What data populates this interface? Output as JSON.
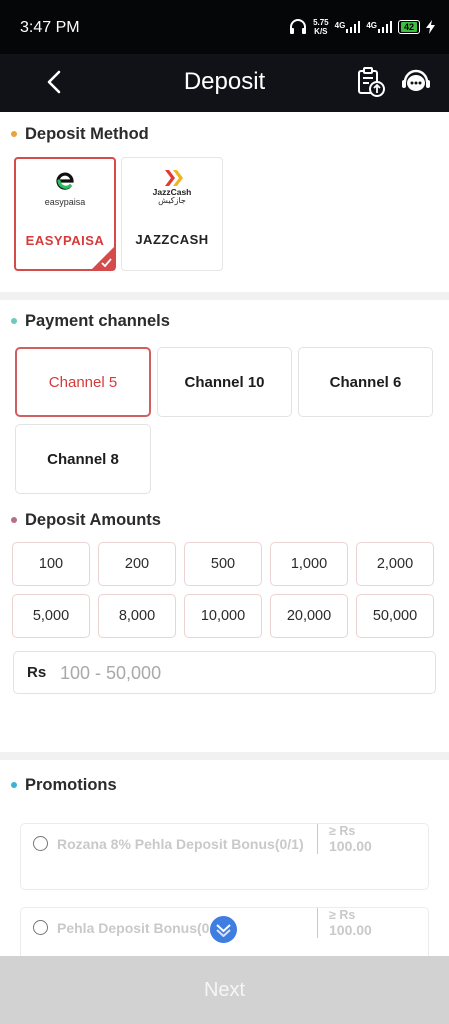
{
  "status_bar": {
    "time": "3:47 PM",
    "net_speed_value": "5.75",
    "net_speed_unit": "K/S",
    "signal1": "4G",
    "signal2": "4G",
    "battery": "42",
    "icons": [
      "headphones-icon",
      "signal-icon",
      "signal-icon",
      "battery-icon",
      "charging-icon"
    ]
  },
  "header": {
    "title": "Deposit",
    "back_icon": "chevron-left-icon",
    "history_icon": "clipboard-upload-icon",
    "support_icon": "customer-service-icon"
  },
  "deposit_method": {
    "title": "Deposit Method",
    "dot_color": "#e8a33a",
    "methods": [
      {
        "logo": "easypaisa",
        "label": "EASYPAISA",
        "selected": true
      },
      {
        "logo": "JazzCash",
        "logo_sub": "جازکیش",
        "label": "JAZZCASH",
        "selected": false
      }
    ]
  },
  "payment_channels": {
    "title": "Payment channels",
    "dot_color": "#6fc7c0",
    "channels": [
      {
        "label": "Channel 5",
        "selected": true
      },
      {
        "label": "Channel 10",
        "selected": false
      },
      {
        "label": "Channel 6",
        "selected": false
      },
      {
        "label": "Channel 8",
        "selected": false
      }
    ]
  },
  "deposit_amounts": {
    "title": "Deposit Amounts",
    "dot_color": "#b76f86",
    "amounts": [
      "100",
      "200",
      "500",
      "1,000",
      "2,000",
      "5,000",
      "8,000",
      "10,000",
      "20,000",
      "50,000"
    ],
    "currency": "Rs",
    "placeholder": "100 - 50,000"
  },
  "promotions": {
    "title": "Promotions",
    "dot_color": "#3bb3d6",
    "items": [
      {
        "name": "Rozana 8% Pehla Deposit Bonus(0/1)",
        "min_prefix": "≥ Rs",
        "min_amount": "100.00"
      },
      {
        "name": "Pehla Deposit Bonus(0/1)",
        "min_prefix": "≥ Rs",
        "min_amount": "100.00"
      }
    ]
  },
  "footer": {
    "next_label": "Next"
  },
  "colors": {
    "accent_red": "#d63a3a",
    "header_bg": "#111118",
    "next_bg": "#d2d2d2"
  }
}
